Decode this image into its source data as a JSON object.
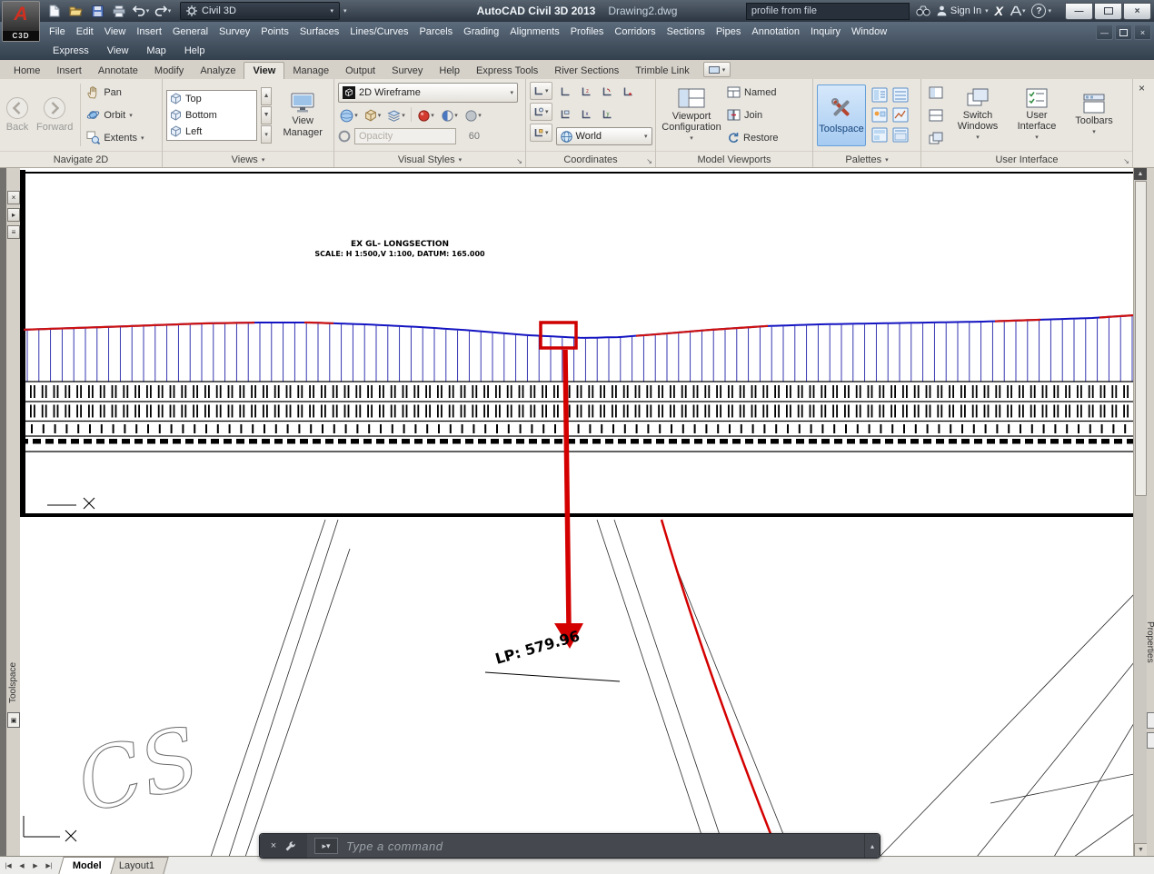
{
  "titlebar": {
    "logo_sub": "C3D",
    "workspace": "Civil 3D",
    "app_title": "AutoCAD Civil 3D 2013",
    "doc_title": "Drawing2.dwg",
    "search_value": "profile from file",
    "signin_label": "Sign In",
    "exchange_label": "X",
    "help_label": "?"
  },
  "menus": {
    "row1": [
      "File",
      "Edit",
      "View",
      "Insert",
      "General",
      "Survey",
      "Points",
      "Surfaces",
      "Lines/Curves",
      "Parcels",
      "Grading",
      "Alignments",
      "Profiles",
      "Corridors",
      "Sections",
      "Pipes",
      "Annotation",
      "Inquiry",
      "Window"
    ],
    "row2": [
      "Express",
      "View",
      "Map",
      "Help"
    ]
  },
  "ribbon": {
    "tabs": [
      {
        "label": "Home"
      },
      {
        "label": "Insert"
      },
      {
        "label": "Annotate"
      },
      {
        "label": "Modify"
      },
      {
        "label": "Analyze"
      },
      {
        "label": "View",
        "active": true
      },
      {
        "label": "Manage"
      },
      {
        "label": "Output"
      },
      {
        "label": "Survey"
      },
      {
        "label": "Help"
      },
      {
        "label": "Express Tools"
      },
      {
        "label": "River Sections"
      },
      {
        "label": "Trimble Link"
      }
    ],
    "navigate": {
      "label": "Navigate 2D",
      "back": "Back",
      "forward": "Forward",
      "pan": "Pan",
      "orbit": "Orbit",
      "extents": "Extents"
    },
    "views": {
      "label": "Views",
      "items": [
        "Top",
        "Bottom",
        "Left"
      ],
      "manager": "View Manager"
    },
    "visual": {
      "label": "Visual Styles",
      "style": "2D Wireframe",
      "opacity_placeholder": "Opacity",
      "opacity_value": "60"
    },
    "coordinates": {
      "label": "Coordinates",
      "world": "World"
    },
    "viewports": {
      "label": "Model Viewports",
      "config": "Viewport Configuration",
      "named": "Named",
      "join": "Join",
      "restore": "Restore"
    },
    "palettes": {
      "label": "Palettes",
      "toolspace": "Toolspace"
    },
    "ui": {
      "label": "User Interface",
      "switch_windows": "Switch Windows",
      "user_interface": "User Interface",
      "toolbars": "Toolbars"
    }
  },
  "drawing": {
    "title1": "EX GL- LONGSECTION",
    "title2": "SCALE: H 1:500,V 1:100, DATUM: 165.000",
    "lp_label": "LP: 579.96",
    "cs_label": "CS"
  },
  "side": {
    "toolspace_tab": "Toolspace",
    "properties_tab": "Properties"
  },
  "command": {
    "placeholder": "Type a command"
  },
  "status": {
    "tabs": [
      {
        "label": "Model",
        "active": true
      },
      {
        "label": "Layout1"
      }
    ]
  }
}
